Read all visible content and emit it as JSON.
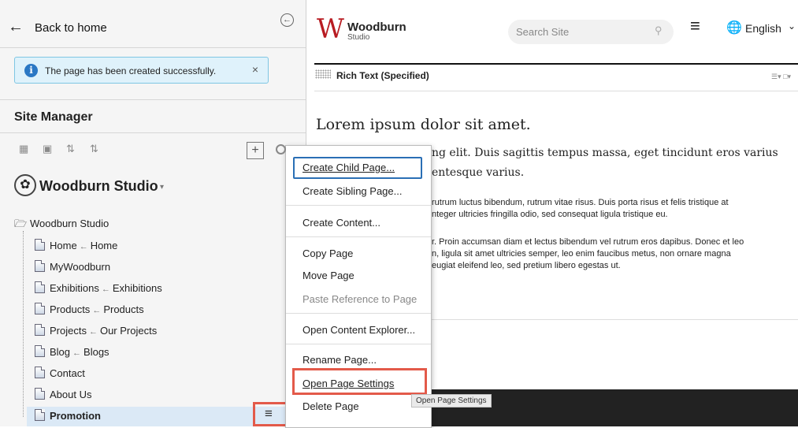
{
  "left_panel": {
    "back_label": "Back to home",
    "alert_text": "The page has been created successfully.",
    "alert_close": "×",
    "site_manager_title": "Site Manager",
    "add_button": "+",
    "site_selector": "Woodburn Studio",
    "tree_root": "Woodburn Studio",
    "tree": [
      {
        "label": "Home",
        "ref": "Home"
      },
      {
        "label": "MyWoodburn",
        "ref": ""
      },
      {
        "label": "Exhibitions",
        "ref": "Exhibitions"
      },
      {
        "label": "Products",
        "ref": "Products"
      },
      {
        "label": "Projects",
        "ref": "Our Projects"
      },
      {
        "label": "Blog",
        "ref": "Blogs"
      },
      {
        "label": "Contact",
        "ref": ""
      },
      {
        "label": "About Us",
        "ref": ""
      },
      {
        "label": "Promotion",
        "ref": ""
      }
    ]
  },
  "header": {
    "brand_name": "Woodburn",
    "brand_sub": "Studio",
    "logo_letter": "W",
    "search_placeholder": "Search Site",
    "language": "English"
  },
  "content": {
    "module_title": "Rich Text (Specified)",
    "heading": "Lorem ipsum dolor sit amet.",
    "lead_line1": "ng elit. Duis sagittis tempus massa, eget tincidunt eros varius",
    "lead_line2": "entesque varius.",
    "para1_line1": "rutrum luctus bibendum, rutrum vitae risus. Duis porta risus et felis tristique at",
    "para1_line2": "nteger ultricies fringilla odio, sed consequat ligula tristique eu.",
    "para2_line1": "r. Proin accumsan diam et lectus bibendum vel rutrum eros dapibus. Donec et leo",
    "para2_line2": "n, ligula sit amet ultricies semper, leo enim faucibus metus, non ornare magna",
    "para2_line3": "eugiat eleifend leo, sed pretium libero egestas ut."
  },
  "context_menu": {
    "items": [
      "Create Child Page...",
      "Create Sibling Page...",
      "Create Content...",
      "Copy Page",
      "Move Page",
      "Paste Reference to Page",
      "Open Content Explorer...",
      "Rename Page...",
      "Open Page Settings",
      "Delete Page"
    ],
    "disabled_item": "Paste Reference to Page",
    "highlighted_item": "Open Page Settings"
  },
  "tooltip": "Open Page Settings",
  "colors": {
    "accent_red": "#e35a4a",
    "brand_red": "#b81c22",
    "info_blue": "#2b78c4"
  }
}
